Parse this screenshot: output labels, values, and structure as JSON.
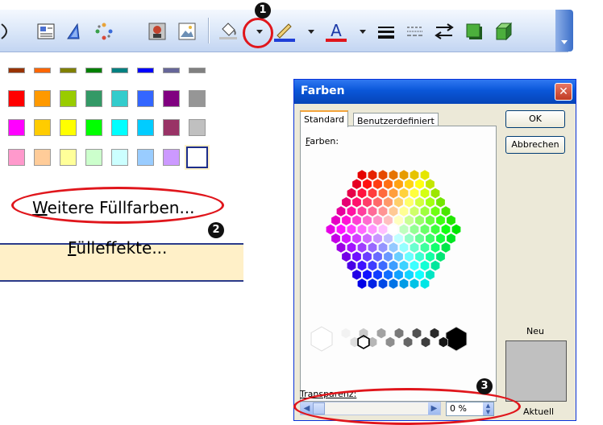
{
  "colors": {
    "accent_red": "#e0161c",
    "fill_blue": "#1f3fd8",
    "font_red": "#e0161c",
    "hover": "#fff0c8"
  },
  "callouts": [
    "1",
    "2",
    "3"
  ],
  "toolbar": {
    "icons": [
      "oval-tool",
      "textbox-tool",
      "wordart-tool",
      "diagram-tool",
      "clipart-tool",
      "picture-tool",
      "fill-color-tool",
      "line-color-tool",
      "font-color-tool",
      "line-style-tool",
      "dash-style-tool",
      "arrow-style-tool",
      "shadow-tool",
      "3d-tool"
    ]
  },
  "menu": {
    "more_fill_colors": "Weitere Füllfarben...",
    "more_fill_colors_mnemonic": "W",
    "fill_effects": "Fülleffekte...",
    "fill_effects_mnemonic": "F",
    "swatch_rows": [
      [
        "#993300",
        "#ff6600",
        "#808000",
        "#008000",
        "#008080",
        "#0000ff",
        "#666699",
        "#808080"
      ],
      [
        "#ff0000",
        "#ff9900",
        "#99cc00",
        "#339966",
        "#33cccc",
        "#3366ff",
        "#800080",
        "#969696"
      ],
      [
        "#ff00ff",
        "#ffcc00",
        "#ffff00",
        "#00ff00",
        "#00ffff",
        "#00ccff",
        "#993366",
        "#c0c0c0"
      ],
      [
        "#ff99cc",
        "#ffcc99",
        "#ffff99",
        "#ccffcc",
        "#ccffff",
        "#99ccff",
        "#cc99ff",
        "#ffffff"
      ]
    ]
  },
  "dialog": {
    "title": "Farben",
    "close_label": "✕",
    "tabs": [
      {
        "label": "Standard",
        "active": true
      },
      {
        "label": "Benutzerdefiniert",
        "active": false
      }
    ],
    "colors_label": "Farben:",
    "colors_mnemonic": "F",
    "ok_label": "OK",
    "cancel_label": "Abbrechen",
    "new_label": "Neu",
    "current_label": "Aktuell",
    "preview_color": "#c0c0c0",
    "transparency_label": "Transparenz:",
    "transparency_value": "0 %",
    "transparency_fraction": 0
  }
}
